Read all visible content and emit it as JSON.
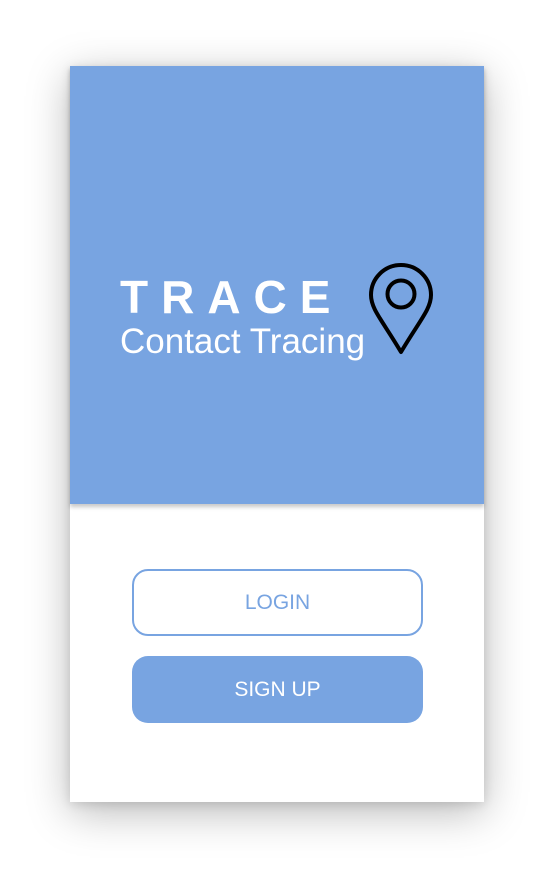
{
  "brand": {
    "name": "TRACE",
    "tagline": "Contact Tracing",
    "icon": "location-pin-icon"
  },
  "actions": {
    "login_label": "LOGIN",
    "signup_label": "SIGN UP"
  },
  "colors": {
    "accent": "#78a4e1",
    "background": "#ffffff",
    "icon": "#000000"
  }
}
